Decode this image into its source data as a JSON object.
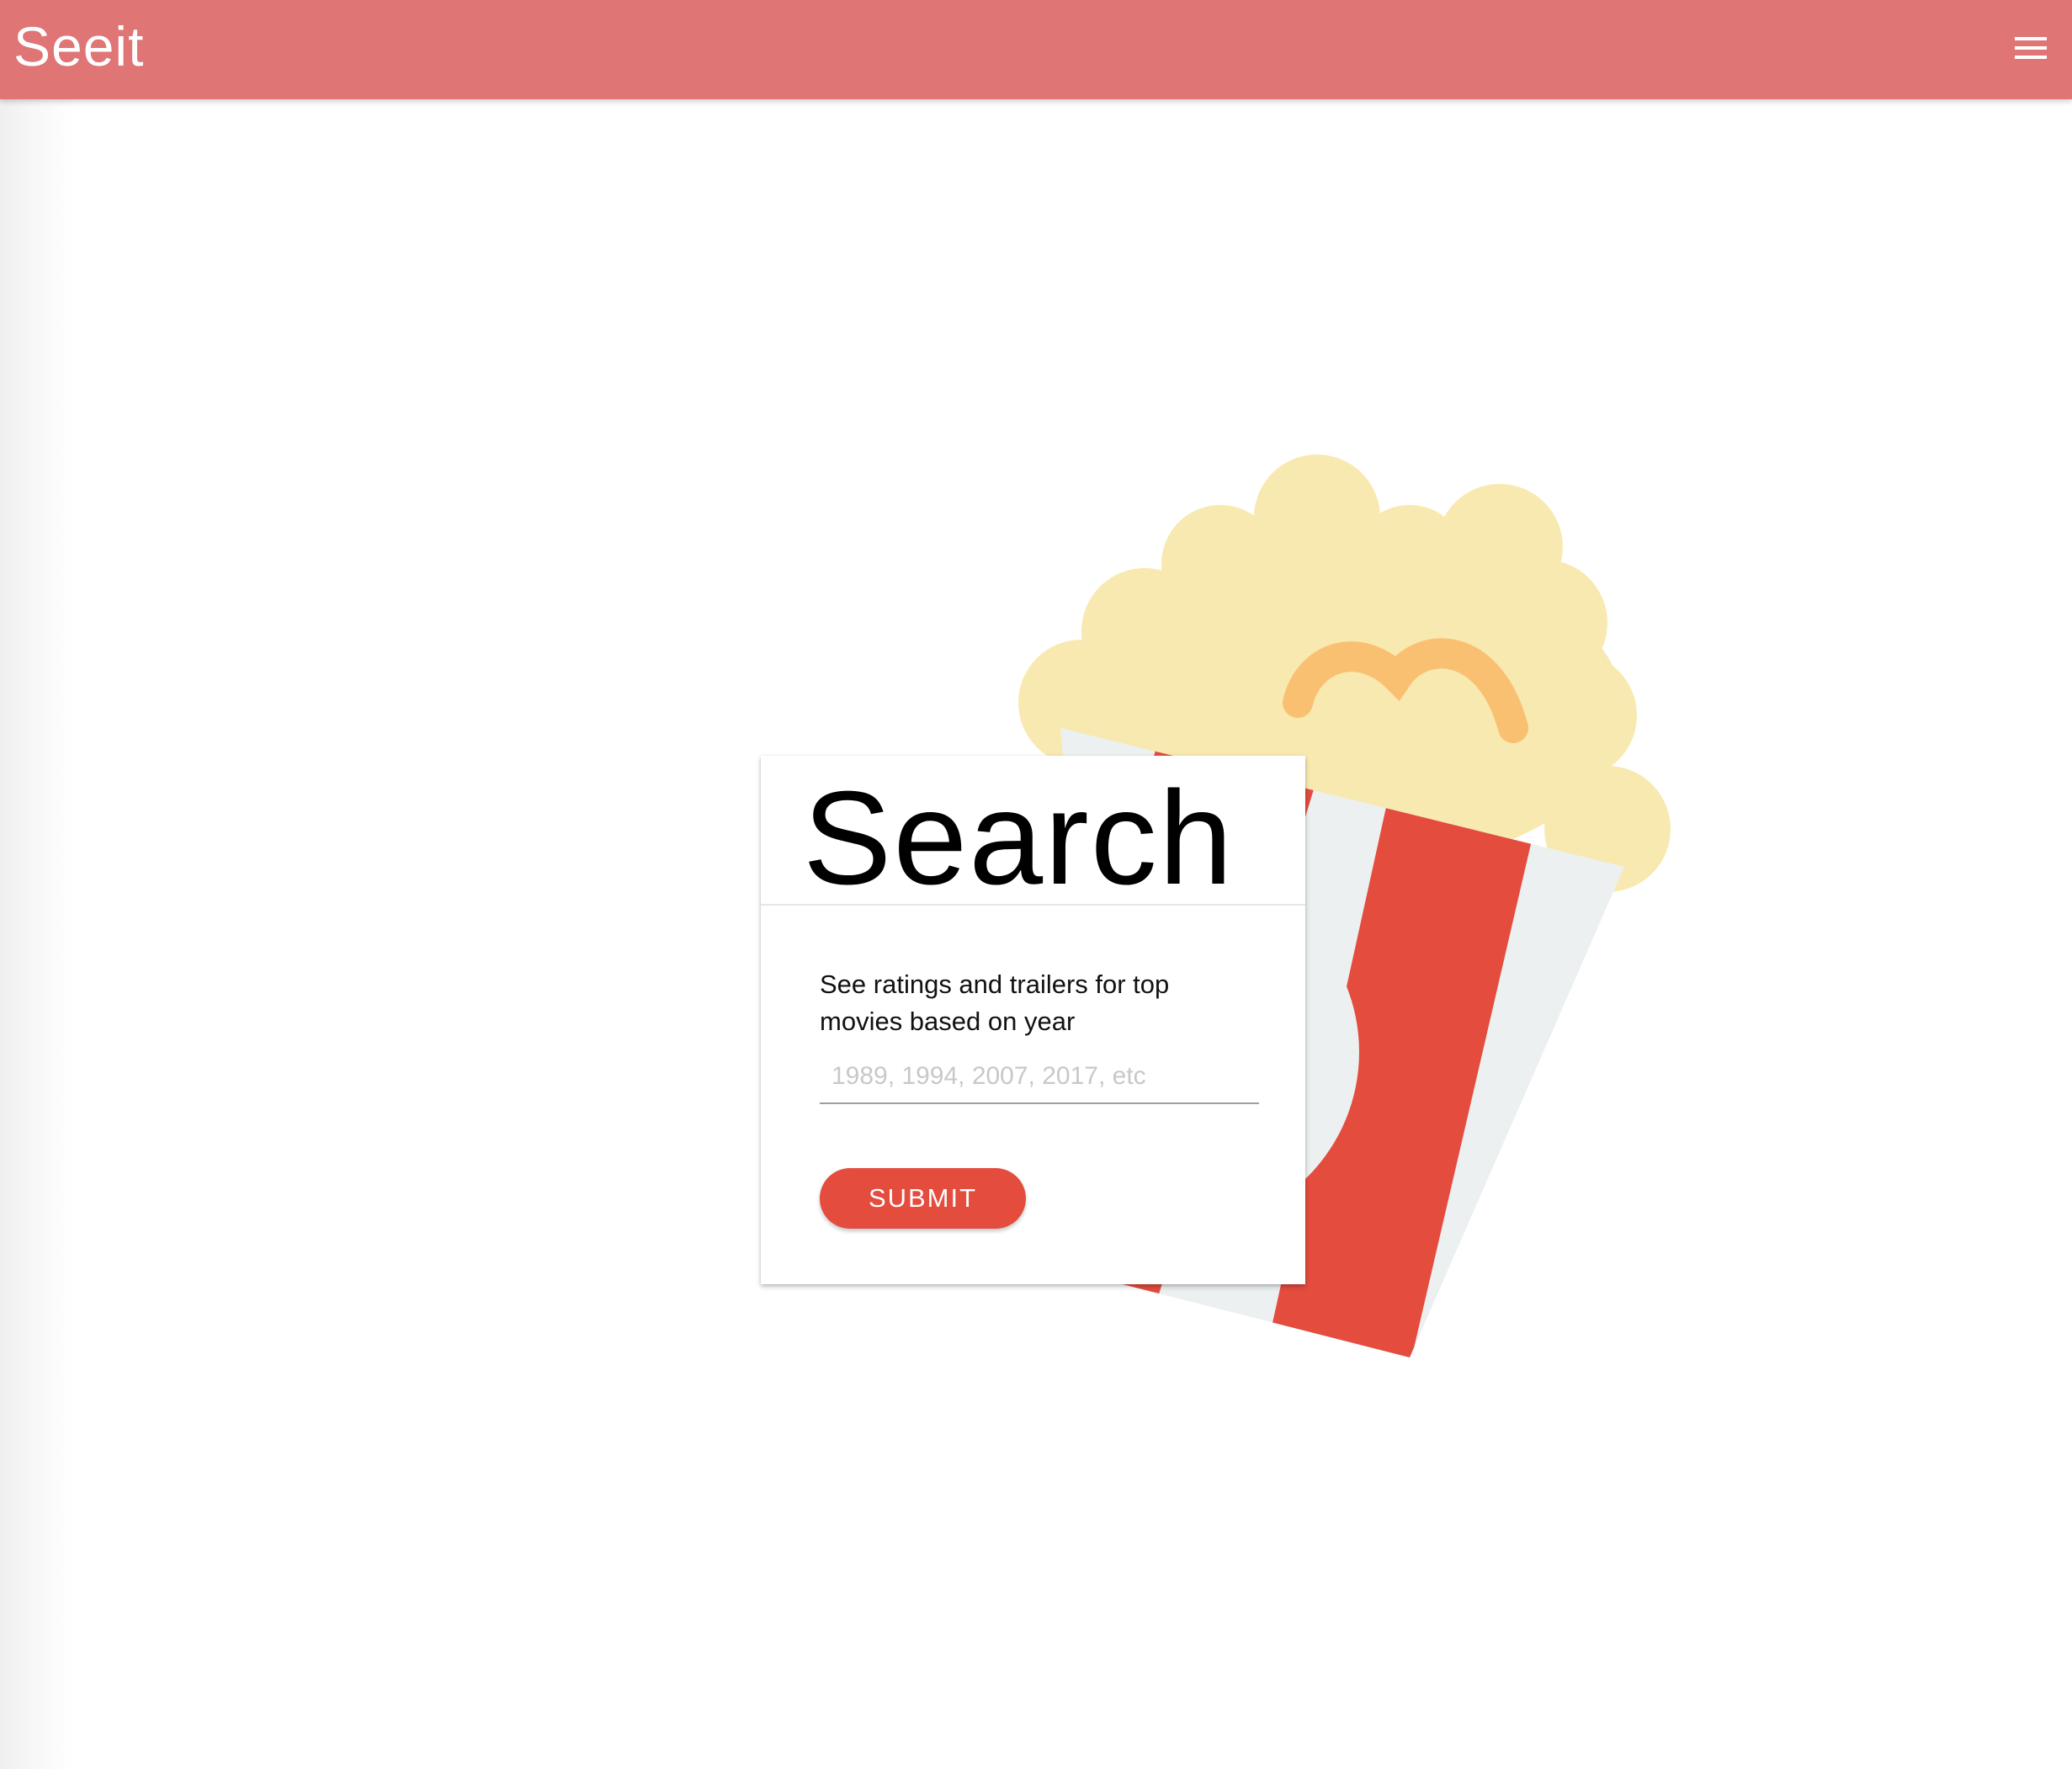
{
  "app": {
    "name": "Seeit",
    "header_color": "#df7575"
  },
  "header": {
    "menu_icon": "hamburger-menu-icon"
  },
  "search_card": {
    "title": "Search",
    "description": "See ratings and trailers for top movies based on year",
    "input": {
      "value": "",
      "placeholder": "1989, 1994, 2007, 2017, etc"
    },
    "submit_label": "SUBMIT",
    "submit_color": "#e44c3e"
  },
  "illustration": {
    "icon": "popcorn-icon",
    "colors": {
      "popcorn": "#f8e9b0",
      "kernel": "#f9c072",
      "stripe_red": "#e44c3e",
      "stripe_white": "#ecf0f1"
    }
  }
}
